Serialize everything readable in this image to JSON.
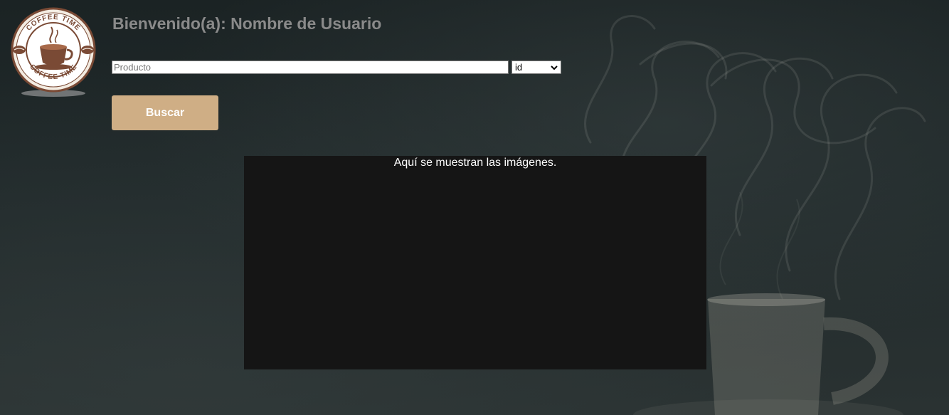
{
  "brand": {
    "logo_text_top": "COFFEE TIME",
    "logo_text_bottom": "COFFEE TIME"
  },
  "header": {
    "title": "Bienvenido(a): Nombre de Usuario"
  },
  "search": {
    "placeholder": "Producto",
    "value": "",
    "filter_selected": "id",
    "button_label": "Buscar"
  },
  "gallery": {
    "message": "Aquí se muestran las imágenes."
  },
  "colors": {
    "button_bg": "#cfae85",
    "title_text": "#8a8a8a",
    "gallery_bg": "#151515"
  }
}
